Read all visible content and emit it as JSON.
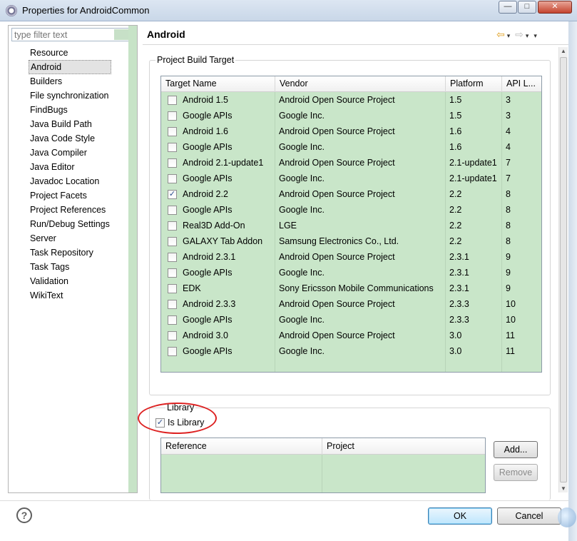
{
  "window": {
    "title": "Properties for AndroidCommon",
    "min_glyph": "—",
    "max_glyph": "□",
    "close_glyph": "✕"
  },
  "filter": {
    "placeholder": "type filter text"
  },
  "nav": {
    "items": [
      "Resource",
      "Android",
      "Builders",
      "File synchronization",
      "FindBugs",
      "Java Build Path",
      "Java Code Style",
      "Java Compiler",
      "Java Editor",
      "Javadoc Location",
      "Project Facets",
      "Project References",
      "Run/Debug Settings",
      "Server",
      "Task Repository",
      "Task Tags",
      "Validation",
      "WikiText"
    ],
    "selected": "Android"
  },
  "page": {
    "title": "Android",
    "back_icon": "⇦",
    "forward_icon": "⇨",
    "dropdown_icon": "▾"
  },
  "build_target": {
    "group_label": "Project Build Target",
    "columns": [
      "Target Name",
      "Vendor",
      "Platform",
      "API L..."
    ],
    "rows": [
      {
        "name": "Android 1.5",
        "vendor": "Android Open Source Project",
        "platform": "1.5",
        "api": "3",
        "checked": false
      },
      {
        "name": "Google APIs",
        "vendor": "Google Inc.",
        "platform": "1.5",
        "api": "3",
        "checked": false
      },
      {
        "name": "Android 1.6",
        "vendor": "Android Open Source Project",
        "platform": "1.6",
        "api": "4",
        "checked": false
      },
      {
        "name": "Google APIs",
        "vendor": "Google Inc.",
        "platform": "1.6",
        "api": "4",
        "checked": false
      },
      {
        "name": "Android 2.1-update1",
        "vendor": "Android Open Source Project",
        "platform": "2.1-update1",
        "api": "7",
        "checked": false
      },
      {
        "name": "Google APIs",
        "vendor": "Google Inc.",
        "platform": "2.1-update1",
        "api": "7",
        "checked": false
      },
      {
        "name": "Android 2.2",
        "vendor": "Android Open Source Project",
        "platform": "2.2",
        "api": "8",
        "checked": true
      },
      {
        "name": "Google APIs",
        "vendor": "Google Inc.",
        "platform": "2.2",
        "api": "8",
        "checked": false
      },
      {
        "name": "Real3D Add-On",
        "vendor": "LGE",
        "platform": "2.2",
        "api": "8",
        "checked": false
      },
      {
        "name": "GALAXY Tab Addon",
        "vendor": "Samsung Electronics Co., Ltd.",
        "platform": "2.2",
        "api": "8",
        "checked": false
      },
      {
        "name": "Android 2.3.1",
        "vendor": "Android Open Source Project",
        "platform": "2.3.1",
        "api": "9",
        "checked": false
      },
      {
        "name": "Google APIs",
        "vendor": "Google Inc.",
        "platform": "2.3.1",
        "api": "9",
        "checked": false
      },
      {
        "name": "EDK",
        "vendor": "Sony Ericsson Mobile Communications",
        "platform": "2.3.1",
        "api": "9",
        "checked": false
      },
      {
        "name": "Android 2.3.3",
        "vendor": "Android Open Source Project",
        "platform": "2.3.3",
        "api": "10",
        "checked": false
      },
      {
        "name": "Google APIs",
        "vendor": "Google Inc.",
        "platform": "2.3.3",
        "api": "10",
        "checked": false
      },
      {
        "name": "Android 3.0",
        "vendor": "Android Open Source Project",
        "platform": "3.0",
        "api": "11",
        "checked": false
      },
      {
        "name": "Google APIs",
        "vendor": "Google Inc.",
        "platform": "3.0",
        "api": "11",
        "checked": false
      }
    ]
  },
  "library": {
    "group_label": "Library",
    "is_library_label": "Is Library",
    "is_library_checked": true,
    "columns": [
      "Reference",
      "Project"
    ],
    "add_label": "Add...",
    "remove_label": "Remove"
  },
  "footer": {
    "help_glyph": "?",
    "ok_label": "OK",
    "cancel_label": "Cancel"
  },
  "colors": {
    "table_bg": "#c9e6c9",
    "annotation": "#dd2222"
  }
}
